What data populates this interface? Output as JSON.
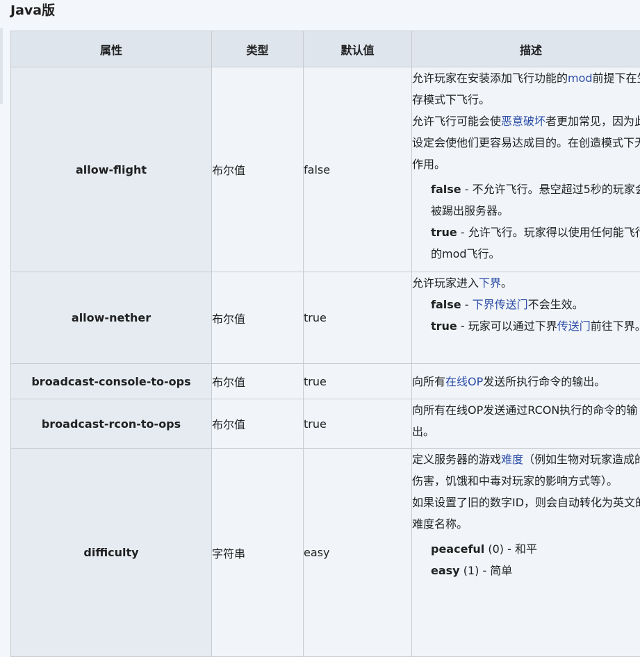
{
  "section_title": "Java版",
  "headers": {
    "property": "属性",
    "type": "类型",
    "default": "默认值",
    "description": "描述"
  },
  "rows": [
    {
      "name": "allow-flight",
      "type": "布尔值",
      "default": "false",
      "desc": {
        "p1_a": "允许玩家在安装添加飞行功能的",
        "p1_link": "mod",
        "p1_b": "前提下在生存模式下飞行。",
        "p2_a": "允许飞行可能会使",
        "p2_link": "恶意破坏",
        "p2_b": "者更加常见，因为此设定会使他们更容易达成目的。在创造模式下无作用。",
        "o1_key": "false",
        "o1_text": " - 不允许飞行。悬空超过5秒的玩家会被踢出服务器。",
        "o2_key": "true",
        "o2_text": " - 允许飞行。玩家得以使用任何能飞行的mod飞行。"
      }
    },
    {
      "name": "allow-nether",
      "type": "布尔值",
      "default": "true",
      "desc": {
        "p1_a": "允许玩家进入",
        "p1_link": "下界",
        "p1_b": "。",
        "o1_key": "false",
        "o1_a": " - ",
        "o1_link": "下界传送门",
        "o1_b": "不会生效。",
        "o2_key": "true",
        "o2_a": " - 玩家可以通过下界",
        "o2_link": "传送门",
        "o2_b": "前往下界。"
      }
    },
    {
      "name": "broadcast-console-to-ops",
      "type": "布尔值",
      "default": "true",
      "desc": {
        "p1_a": "向所有",
        "p1_link": "在线OP",
        "p1_b": "发送所执行命令的输出。"
      }
    },
    {
      "name": "broadcast-rcon-to-ops",
      "type": "布尔值",
      "default": "true",
      "desc": {
        "p1_a": "向所有在线OP发送通过RCON执行的命令的输出。"
      }
    },
    {
      "name": "difficulty",
      "type": "字符串",
      "default": "easy",
      "desc": {
        "p1_a": "定义服务器的游戏",
        "p1_link": "难度",
        "p1_b": "（例如生物对玩家造成的伤害，饥饿和中毒对玩家的影响方式等）。",
        "p2_a": "如果设置了旧的数字ID，则会自动转化为英文的难度名称。",
        "o1_key": "peaceful",
        "o1_text": " (0) - 和平",
        "o2_key": "easy",
        "o2_text": " (1) - 简单"
      }
    }
  ]
}
